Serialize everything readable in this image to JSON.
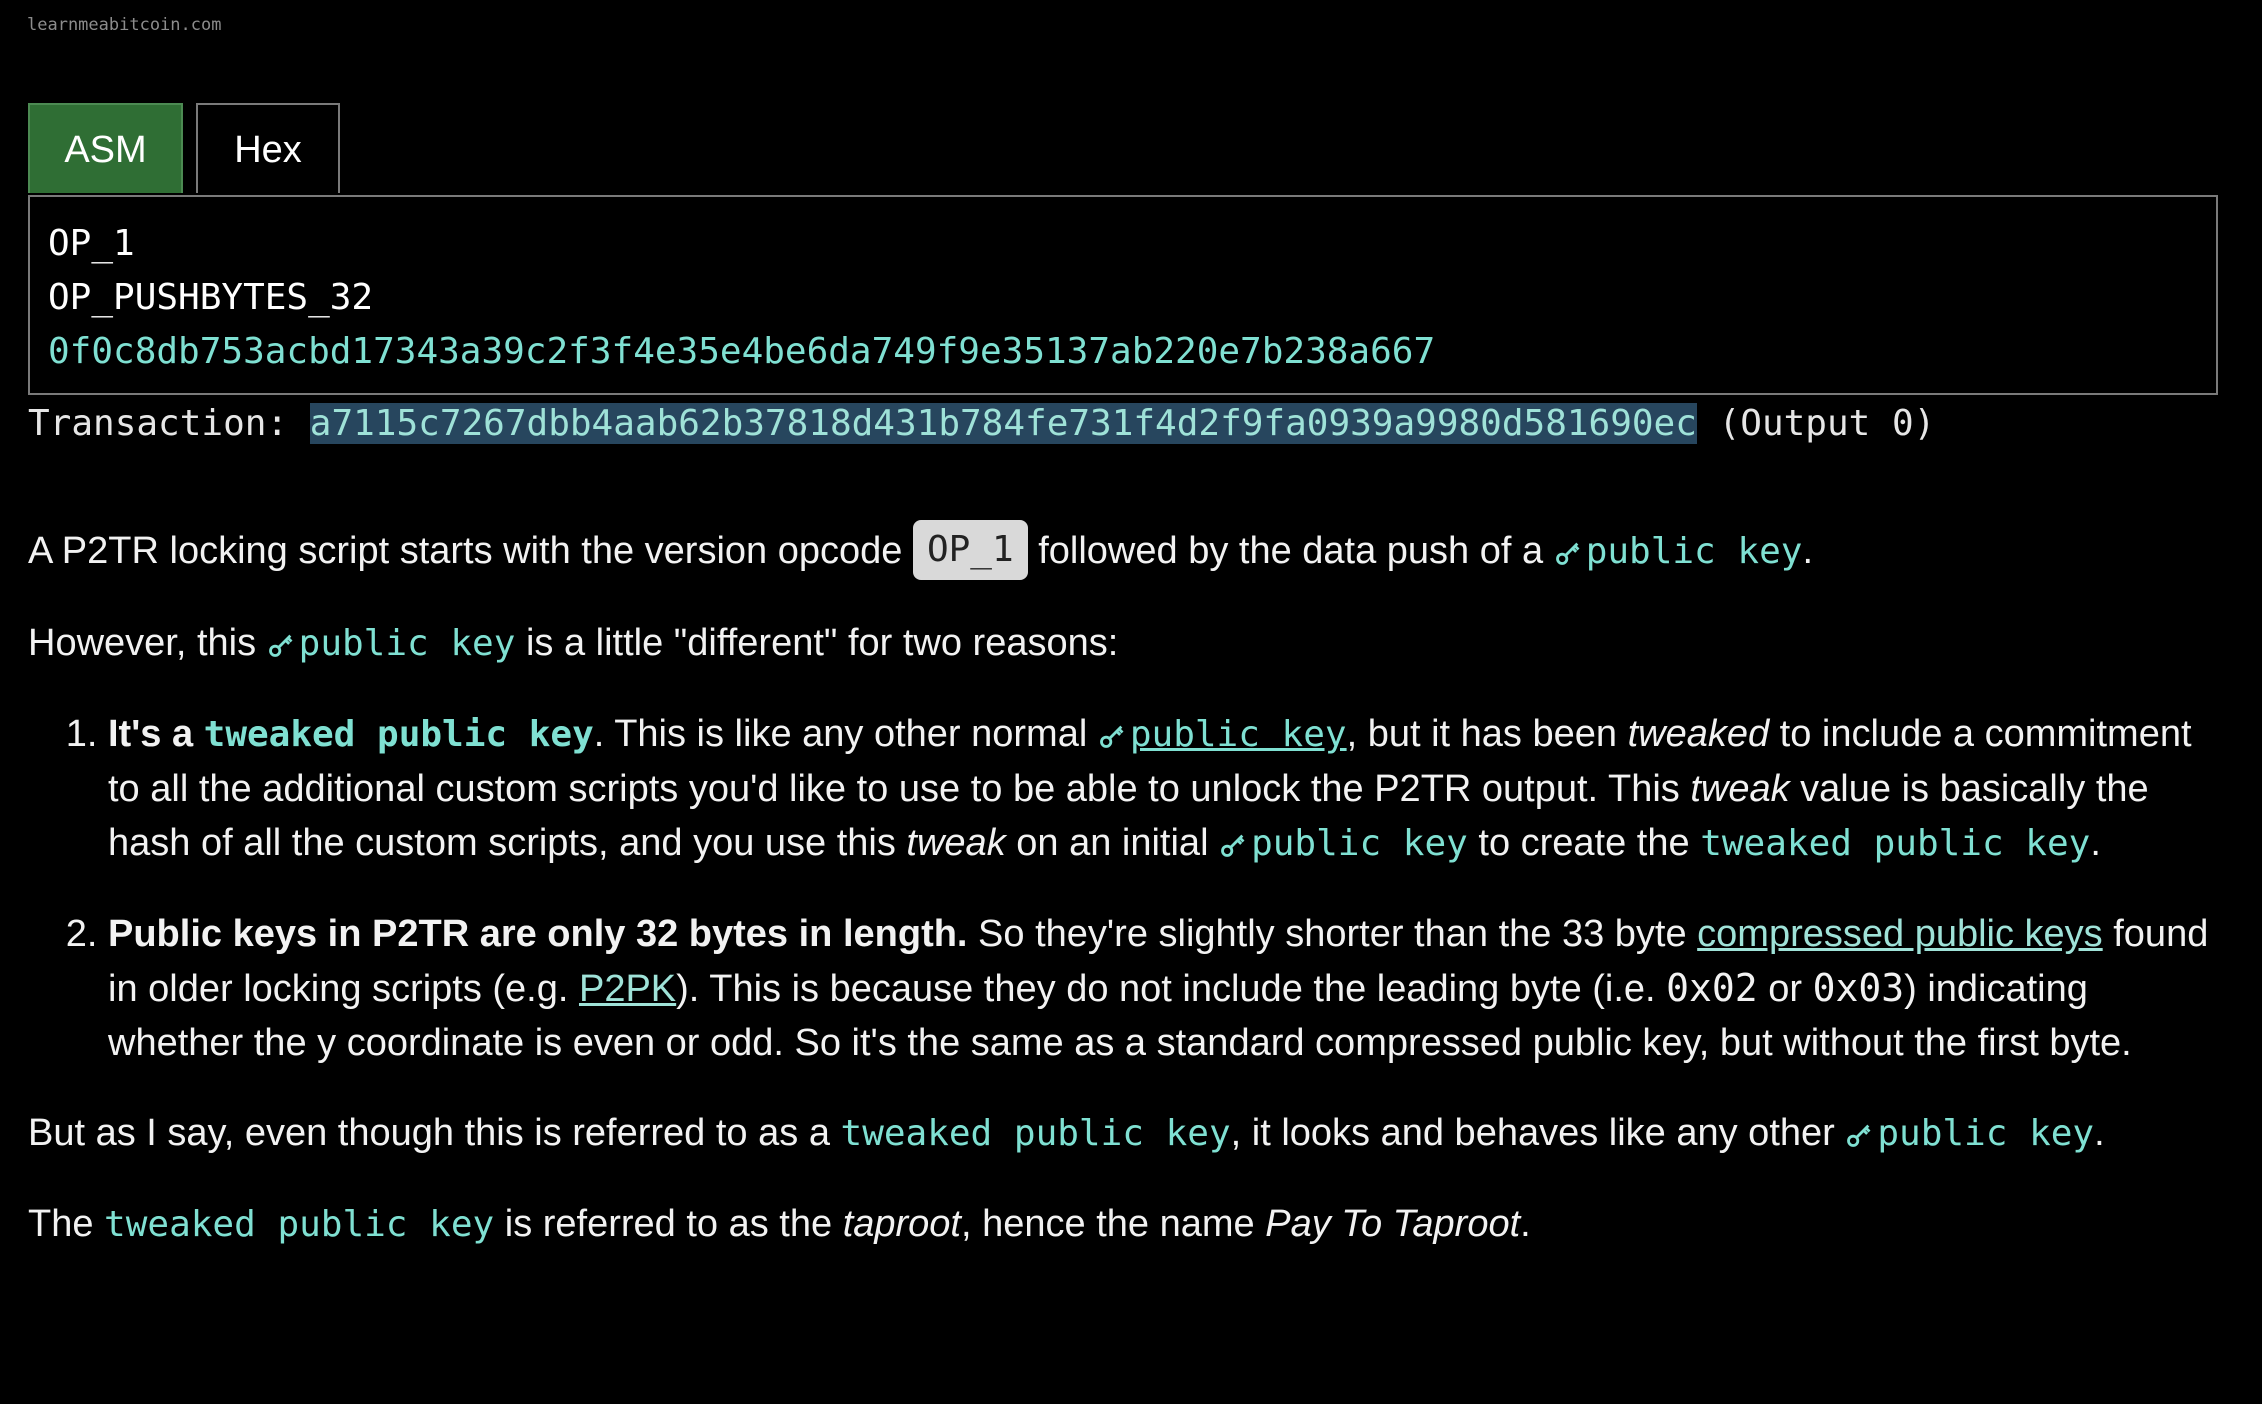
{
  "site": {
    "url": "learnmeabitcoin.com"
  },
  "tabs": [
    {
      "label": "ASM",
      "active": true
    },
    {
      "label": "Hex",
      "active": false
    }
  ],
  "script": {
    "line1": "OP_1",
    "line2": "OP_PUSHBYTES_32",
    "line3": "0f0c8db753acbd17343a39c2f3f4e35e4be6da749f9e35137ab220e7b238a667"
  },
  "transaction": {
    "label": "Transaction:",
    "txid": "a7115c7267dbb4aab62b37818d431b784fe731f4d2f9fa0939a9980d581690ec",
    "output": "(Output 0)"
  },
  "text": {
    "p1_a": "A P2TR locking script starts with the version opcode ",
    "p1_opcode": "OP_1",
    "p1_b": " followed by the data push of a ",
    "public_key": "public key",
    "p1_end": ".",
    "p2_a": "However, this ",
    "p2_b": " is a little \"different\" for two reasons:",
    "li1_bold_a": "It's a ",
    "tweaked_public_key": "tweaked public key",
    "li1_a": ". This is like any other normal ",
    "li1_b": ", but it has been ",
    "li1_tweaked_word": "tweaked",
    "li1_c": " to include a commitment to all the additional custom scripts you'd like to use to be able to unlock the P2TR output. This ",
    "li1_tweak_word": "tweak",
    "li1_d": " value is basically the hash of all the custom scripts, and you use this ",
    "li1_e": " on an initial ",
    "li1_f": " to create the ",
    "li1_end": ".",
    "li2_bold": "Public keys in P2TR are only 32 bytes in length.",
    "li2_a": " So they're slightly shorter than the 33 byte ",
    "li2_link1": "compressed public keys",
    "li2_b": " found in older locking scripts (e.g. ",
    "li2_link2": "P2PK",
    "li2_c": "). This is because they do not include the leading byte (i.e. ",
    "li2_code1": "0x02",
    "li2_or": " or ",
    "li2_code2": "0x03",
    "li2_d": ") indicating whether the y coordinate is even or odd. So it's the same as a standard compressed public key, but without the first byte.",
    "p3_a": "But as I say, even though this is referred to as a ",
    "p3_b": ", it looks and behaves like any other ",
    "p3_end": ".",
    "p4_a": "The ",
    "p4_b": " is referred to as the ",
    "p4_taproot": "taproot",
    "p4_c": ", hence the name ",
    "p4_name": "Pay To Taproot",
    "p4_end": "."
  },
  "colors": {
    "accent": "#7fe0d2",
    "tab_active": "#2f6e34",
    "highlight": "#27465e",
    "opcode_bg": "#d9d9d9"
  }
}
